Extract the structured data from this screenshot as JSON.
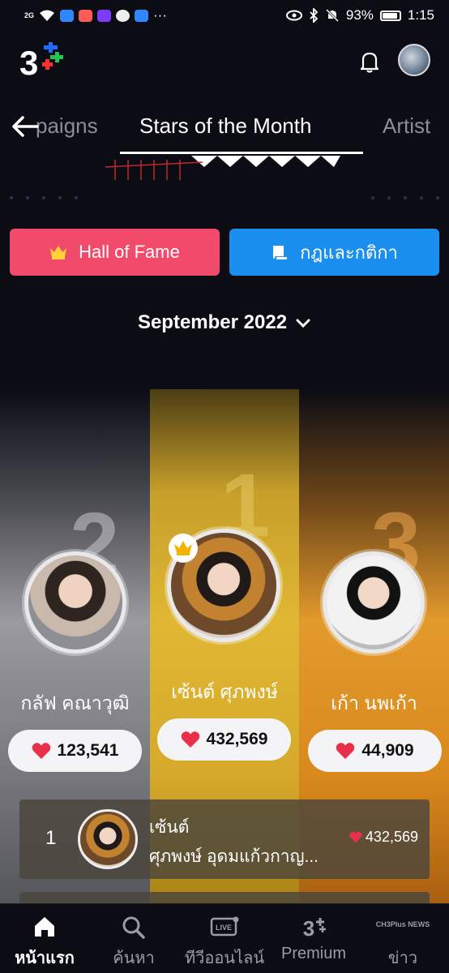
{
  "status_bar": {
    "network": "2G",
    "battery": "93%",
    "time": "1:15",
    "more": "···"
  },
  "header": {
    "logo_text": "3",
    "icons": [
      "bell-icon",
      "profile-avatar"
    ]
  },
  "tabs": {
    "prev": "paigns",
    "active": "Stars of the Month",
    "next": "Artist"
  },
  "buttons": {
    "hall_of_fame": "Hall of Fame",
    "rules": "กฎและกติกา"
  },
  "month_selector": {
    "label": "September 2022"
  },
  "podium": {
    "first": {
      "rank": "1",
      "name": "เซ้นต์ ศุภพงษ์",
      "votes": "432,569"
    },
    "second": {
      "rank": "2",
      "name": "กลัฟ คณาวุฒิ",
      "votes": "123,541"
    },
    "third": {
      "rank": "3",
      "name": "เก้า นพเก้า",
      "votes": "44,909"
    }
  },
  "ranking_list": [
    {
      "rank": "1",
      "first_name": "เซ้นต์",
      "last_name": "ศุภพงษ์ อุดมแก้วกาญ...",
      "votes": "432,569"
    }
  ],
  "bottom_nav": {
    "items": [
      {
        "label": "หน้าแรก",
        "icon": "home-icon",
        "active": true
      },
      {
        "label": "ค้นหา",
        "icon": "search-icon",
        "active": false
      },
      {
        "label": "ทีวีออนไลน์",
        "icon": "live-tv-icon",
        "badge": "LIVE",
        "active": false
      },
      {
        "label": "Premium",
        "icon": "premium-icon",
        "badge": "3",
        "active": false
      },
      {
        "label": "ข่าว",
        "icon": "news-icon",
        "badge": "CH3Plus NEWS",
        "active": false
      }
    ]
  },
  "colors": {
    "background": "#0b0c14",
    "hall_of_fame": "#f24a6a",
    "rules": "#1a8fef",
    "heart": "#e8304a",
    "gold": "#e0b733",
    "silver": "#9a9aa0",
    "bronze": "#e39a2c"
  }
}
